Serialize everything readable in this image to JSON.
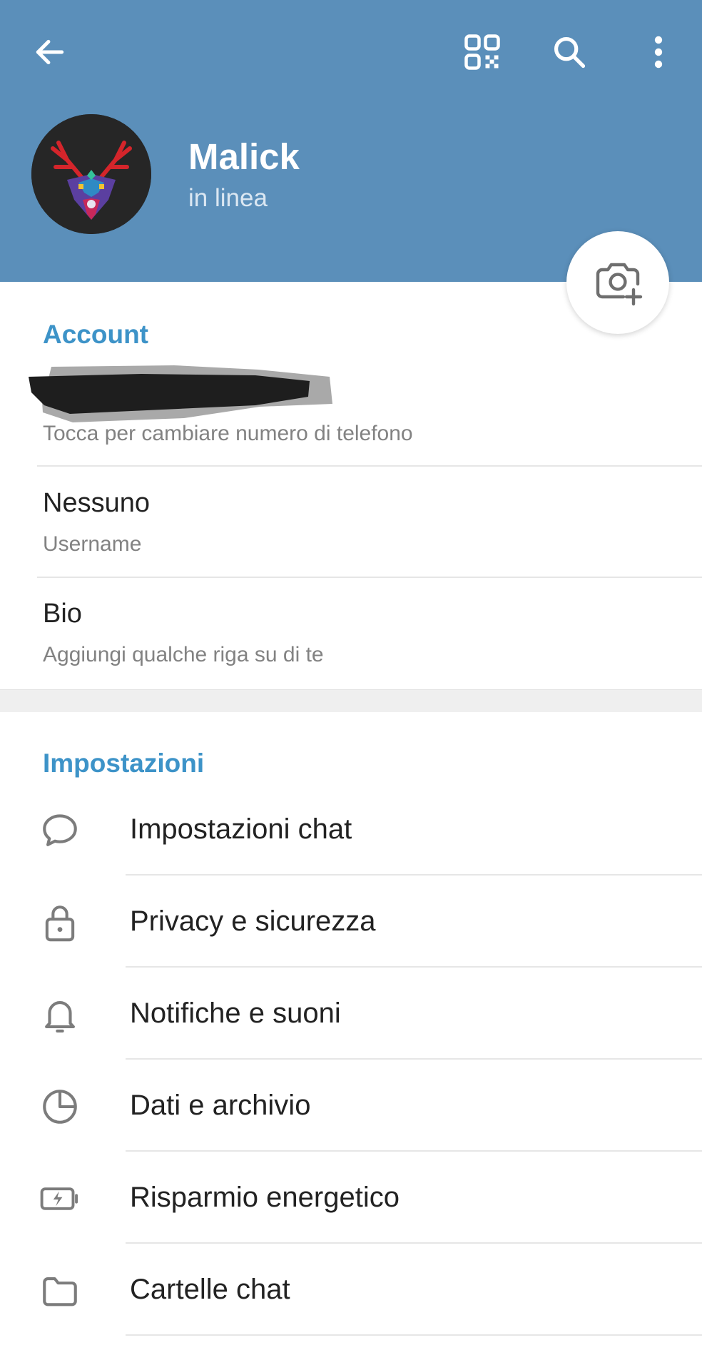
{
  "header": {
    "name": "Malick",
    "status": "in linea",
    "background_color": "#5b8fba",
    "icons": [
      "back-arrow-icon",
      "qr-code-icon",
      "search-icon",
      "more-vertical-icon"
    ]
  },
  "avatar": {
    "description_icon": "deer-avatar-icon"
  },
  "account": {
    "section_title": "Account",
    "phone_hint": "Tocca per cambiare numero di telefono",
    "username_value": "Nessuno",
    "username_label": "Username",
    "bio_value": "Bio",
    "bio_hint": "Aggiungi qualche riga su di te"
  },
  "settings": {
    "section_title": "Impostazioni",
    "items": [
      {
        "label": "Impostazioni chat",
        "icon": "chat-bubble-icon"
      },
      {
        "label": "Privacy e sicurezza",
        "icon": "lock-icon"
      },
      {
        "label": "Notifiche e suoni",
        "icon": "bell-icon"
      },
      {
        "label": "Dati e archivio",
        "icon": "pie-chart-icon"
      },
      {
        "label": "Risparmio energetico",
        "icon": "battery-icon"
      },
      {
        "label": "Cartelle chat",
        "icon": "folder-icon"
      }
    ]
  },
  "colors": {
    "accent": "#3d93c8",
    "header": "#5b8fba"
  }
}
